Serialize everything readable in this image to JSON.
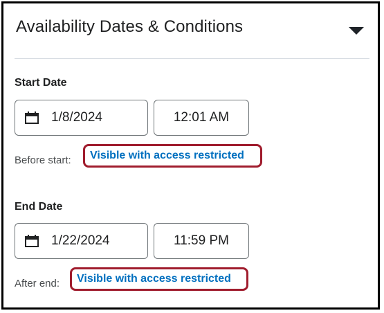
{
  "panel": {
    "title": "Availability Dates & Conditions",
    "collapse_icon": "caret-down-icon"
  },
  "start": {
    "label": "Start Date",
    "date": "1/8/2024",
    "time": "12:01 AM",
    "calendar_icon": "calendar-icon",
    "helper_prefix": "Before start:",
    "link": "Visible with access restricted"
  },
  "end": {
    "label": "End Date",
    "date": "1/22/2024",
    "time": "11:59 PM",
    "calendar_icon": "calendar-icon",
    "helper_prefix": "After end:",
    "link": "Visible with access restricted"
  },
  "colors": {
    "link": "#006fbf",
    "highlight_border": "#a01c2d",
    "frame_border": "#000000"
  }
}
